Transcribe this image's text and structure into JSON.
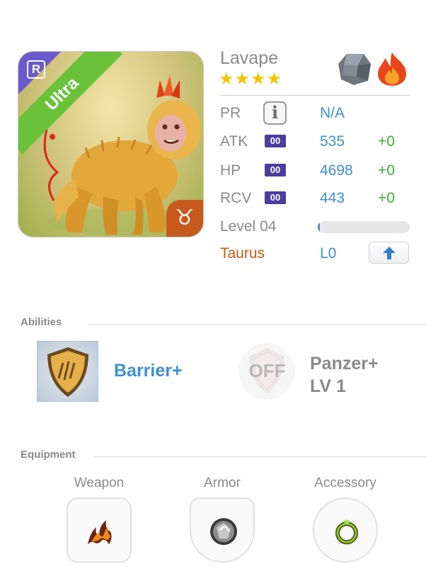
{
  "monster": {
    "name": "Lavape",
    "stars": "★★★★",
    "rarity_badge": "R",
    "rarity_banner": "Ultra",
    "zodiac_symbol": "♉",
    "elements": [
      "rock-icon",
      "fire-icon"
    ]
  },
  "stats": {
    "pr_label": "PR",
    "pr_value": "N/A",
    "info_glyph": "i",
    "atk_label": "ATK",
    "atk_badge": "00",
    "atk_value": "535",
    "atk_plus": "+0",
    "hp_label": "HP",
    "hp_badge": "00",
    "hp_value": "4698",
    "hp_plus": "+0",
    "rcv_label": "RCV",
    "rcv_badge": "00",
    "rcv_value": "443",
    "rcv_plus": "+0",
    "level_label": "Level 04",
    "level_progress": 0.02,
    "zodiac_label": "Taurus",
    "awakening_level": "L0"
  },
  "abilities": {
    "title": "Abilities",
    "primary_name": "Barrier+",
    "secondary_status": "OFF",
    "secondary_name_line1": "Panzer+",
    "secondary_name_line2": "LV 1"
  },
  "equipment": {
    "title": "Equipment",
    "slots": [
      {
        "label": "Weapon",
        "icon": "flame-claw-icon"
      },
      {
        "label": "Armor",
        "icon": "stone-orb-icon"
      },
      {
        "label": "Accessory",
        "icon": "green-ring-icon"
      }
    ]
  },
  "colors": {
    "accent_blue": "#3f8fd2",
    "plus_green": "#3cae3c",
    "badge_purple": "#4b3c9e",
    "zodiac_orange": "#c35a18",
    "rarity_green": "#6ac23a",
    "star_gold": "#f5c400"
  }
}
